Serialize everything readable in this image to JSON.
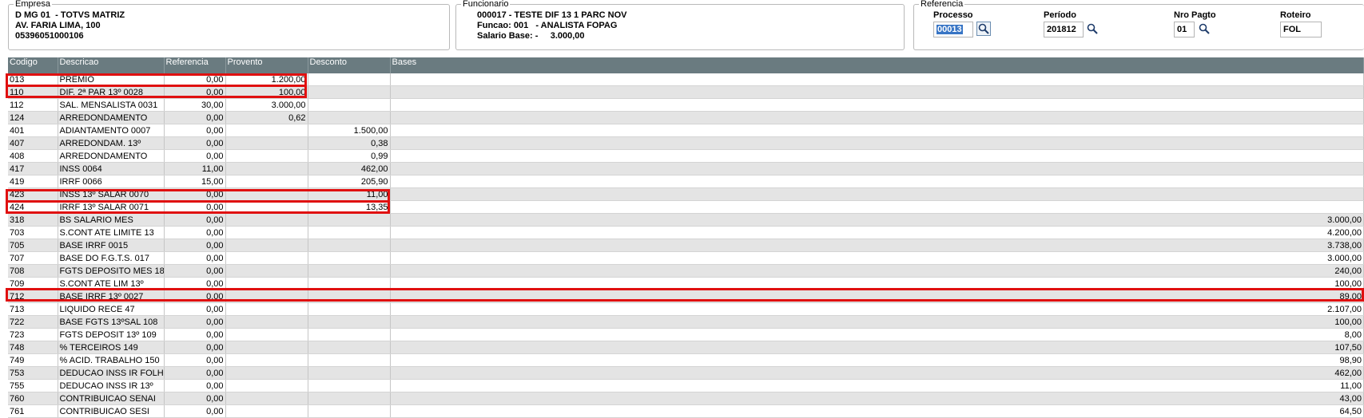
{
  "empresa": {
    "legend": "Empresa",
    "line1": "D MG 01  - TOTVS MATRIZ",
    "line2": "AV. FARIA LIMA, 100",
    "line3": "05396051000106"
  },
  "funcionario": {
    "legend": "Funcionario",
    "line1": "000017 - TESTE DIF 13 1 PARC NOV",
    "line2": "Funcao: 001   - ANALISTA FOPAG",
    "line3": "Salario Base: -     3.000,00"
  },
  "referencia": {
    "legend": "Referencia",
    "processo_label": "Processo",
    "processo_value": "00013",
    "periodo_label": "Período",
    "periodo_value": "201812",
    "nro_pagto_label": "Nro Pagto",
    "nro_pagto_value": "01",
    "roteiro_label": "Roteiro",
    "roteiro_value": "FOL",
    "search_icon": "magnifier-icon"
  },
  "grid": {
    "headers": {
      "codigo": "Codigo",
      "descricao": "Descricao",
      "referencia": "Referencia",
      "provento": "Provento",
      "desconto": "Desconto",
      "bases": "Bases"
    },
    "rows": [
      {
        "codigo": "013",
        "descricao": "PREMIO",
        "referencia": "0,00",
        "provento": "1.200,00",
        "desconto": "",
        "bases": ""
      },
      {
        "codigo": "110",
        "descricao": "DIF. 2ª PAR 13º 0028",
        "referencia": "0,00",
        "provento": "100,00",
        "desconto": "",
        "bases": ""
      },
      {
        "codigo": "112",
        "descricao": "SAL. MENSALISTA 0031",
        "referencia": "30,00",
        "provento": "3.000,00",
        "desconto": "",
        "bases": ""
      },
      {
        "codigo": "124",
        "descricao": "ARREDONDAMENTO",
        "referencia": "0,00",
        "provento": "0,62",
        "desconto": "",
        "bases": ""
      },
      {
        "codigo": "401",
        "descricao": "ADIANTAMENTO 0007",
        "referencia": "0,00",
        "provento": "",
        "desconto": "1.500,00",
        "bases": ""
      },
      {
        "codigo": "407",
        "descricao": "ARREDONDAM. 13º",
        "referencia": "0,00",
        "provento": "",
        "desconto": "0,38",
        "bases": ""
      },
      {
        "codigo": "408",
        "descricao": "ARREDONDAMENTO",
        "referencia": "0,00",
        "provento": "",
        "desconto": "0,99",
        "bases": ""
      },
      {
        "codigo": "417",
        "descricao": "INSS 0064",
        "referencia": "11,00",
        "provento": "",
        "desconto": "462,00",
        "bases": ""
      },
      {
        "codigo": "419",
        "descricao": "IRRF 0066",
        "referencia": "15,00",
        "provento": "",
        "desconto": "205,90",
        "bases": ""
      },
      {
        "codigo": "423",
        "descricao": "INSS 13º SALAR 0070",
        "referencia": "0,00",
        "provento": "",
        "desconto": "11,00",
        "bases": ""
      },
      {
        "codigo": "424",
        "descricao": "IRRF 13º SALAR 0071",
        "referencia": "0,00",
        "provento": "",
        "desconto": "13,35",
        "bases": ""
      },
      {
        "codigo": "318",
        "descricao": "BS SALARIO MES",
        "referencia": "0,00",
        "provento": "",
        "desconto": "",
        "bases": "3.000,00"
      },
      {
        "codigo": "703",
        "descricao": "S.CONT ATE LIMITE 13",
        "referencia": "0,00",
        "provento": "",
        "desconto": "",
        "bases": "4.200,00"
      },
      {
        "codigo": "705",
        "descricao": "BASE IRRF 0015",
        "referencia": "0,00",
        "provento": "",
        "desconto": "",
        "bases": "3.738,00"
      },
      {
        "codigo": "707",
        "descricao": "BASE DO F.G.T.S. 017",
        "referencia": "0,00",
        "provento": "",
        "desconto": "",
        "bases": "3.000,00"
      },
      {
        "codigo": "708",
        "descricao": "FGTS DEPOSITO MES 18",
        "referencia": "0,00",
        "provento": "",
        "desconto": "",
        "bases": "240,00"
      },
      {
        "codigo": "709",
        "descricao": "S.CONT ATE LIM 13º",
        "referencia": "0,00",
        "provento": "",
        "desconto": "",
        "bases": "100,00"
      },
      {
        "codigo": "712",
        "descricao": "BASE IRRF 13º 0027",
        "referencia": "0,00",
        "provento": "",
        "desconto": "",
        "bases": "89,00"
      },
      {
        "codigo": "713",
        "descricao": "LIQUIDO RECE 47",
        "referencia": "0,00",
        "provento": "",
        "desconto": "",
        "bases": "2.107,00"
      },
      {
        "codigo": "722",
        "descricao": "BASE FGTS 13ºSAL 108",
        "referencia": "0,00",
        "provento": "",
        "desconto": "",
        "bases": "100,00"
      },
      {
        "codigo": "723",
        "descricao": "FGTS DEPOSIT 13º 109",
        "referencia": "0,00",
        "provento": "",
        "desconto": "",
        "bases": "8,00"
      },
      {
        "codigo": "748",
        "descricao": "% TERCEIROS 149",
        "referencia": "0,00",
        "provento": "",
        "desconto": "",
        "bases": "107,50"
      },
      {
        "codigo": "749",
        "descricao": "% ACID. TRABALHO 150",
        "referencia": "0,00",
        "provento": "",
        "desconto": "",
        "bases": "98,90"
      },
      {
        "codigo": "753",
        "descricao": "DEDUCAO INSS IR FOLH",
        "referencia": "0,00",
        "provento": "",
        "desconto": "",
        "bases": "462,00"
      },
      {
        "codigo": "755",
        "descricao": "DEDUCAO INSS IR 13º",
        "referencia": "0,00",
        "provento": "",
        "desconto": "",
        "bases": "11,00"
      },
      {
        "codigo": "760",
        "descricao": "CONTRIBUICAO SENAI",
        "referencia": "0,00",
        "provento": "",
        "desconto": "",
        "bases": "43,00"
      },
      {
        "codigo": "761",
        "descricao": "CONTRIBUICAO SESI",
        "referencia": "0,00",
        "provento": "",
        "desconto": "",
        "bases": "64,50"
      }
    ]
  },
  "highlight_color": "#e01010"
}
